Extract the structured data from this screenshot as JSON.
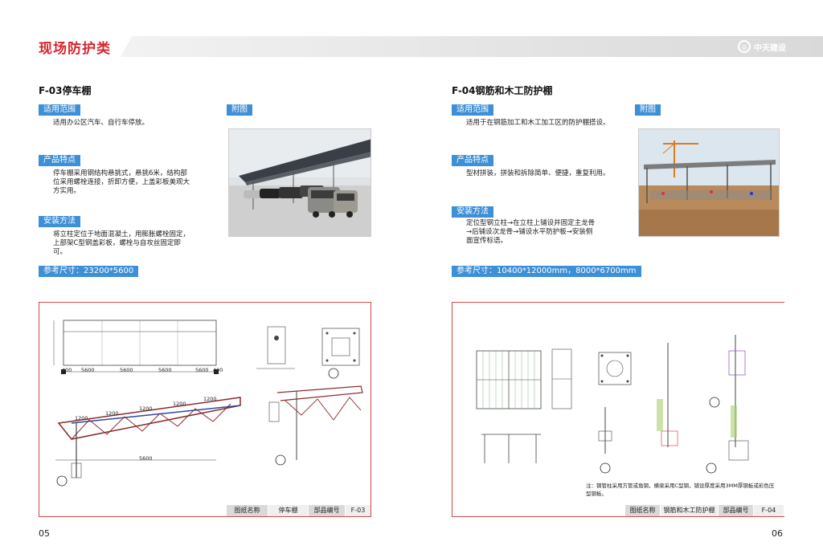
{
  "header": {
    "title": "现场防护类",
    "logo_text": "中天建设"
  },
  "left": {
    "code_title": "F-03停车棚",
    "scope_label": "适用范围",
    "scope_text": "适用办公区汽车、自行车停放。",
    "photo_label": "附图",
    "features_label": "产品特点",
    "features_text": [
      "停车棚采用钢结构悬挑式，悬挑6米，结构部",
      "位采用螺栓连接，折卸方便，上盖彩板美观大",
      "方实用。"
    ],
    "install_label": "安装方法",
    "install_text": [
      "将立柱定位于地面混凝土，用膨胀螺栓固定，",
      "上部架C型钢盖彩板，螺栓与自攻丝固定即",
      "可。"
    ],
    "size_label": "参考尺寸：23200*5600",
    "title_block": {
      "name_label": "图纸名称",
      "name_value": "停车棚",
      "code_label": "部品编号",
      "code_value": "F-03"
    },
    "dims": [
      "5600",
      "5600",
      "5600",
      "5600",
      "400",
      "400",
      "5600",
      "1200",
      "1200",
      "1200",
      "1200",
      "1200"
    ],
    "page": "05"
  },
  "right": {
    "code_title": "F-04钢筋和木工防护棚",
    "scope_label": "适用范围",
    "scope_text": "适用于在钢筋加工和木工加工区的防护棚搭设。",
    "photo_label": "附图",
    "features_label": "产品特点",
    "features_text": [
      "型材拼装，拼装和拆除简单、便捷，重复利用。"
    ],
    "install_label": "安装方法",
    "install_text": [
      "定位型钢立柱→在立柱上铺设并固定主龙骨",
      "→后铺设次龙骨→铺设水平防护板→安装侧",
      "面宣传标语。"
    ],
    "size_label": "参考尺寸：10400*12000mm，8000*6700mm",
    "note": "注：钢管柱采用方管或角钢，横梁采用C型钢，铺设厚度采用3MM厚钢板或彩色压型钢板。",
    "title_block": {
      "name_label": "图纸名称",
      "name_value": "钢筋和木工防护棚",
      "code_label": "部品编号",
      "code_value": "F-04"
    },
    "page": "06"
  },
  "colors": {
    "accent_red": "#d7262c",
    "label_blue": "#3d8fd6",
    "frame_red": "#d04848"
  }
}
